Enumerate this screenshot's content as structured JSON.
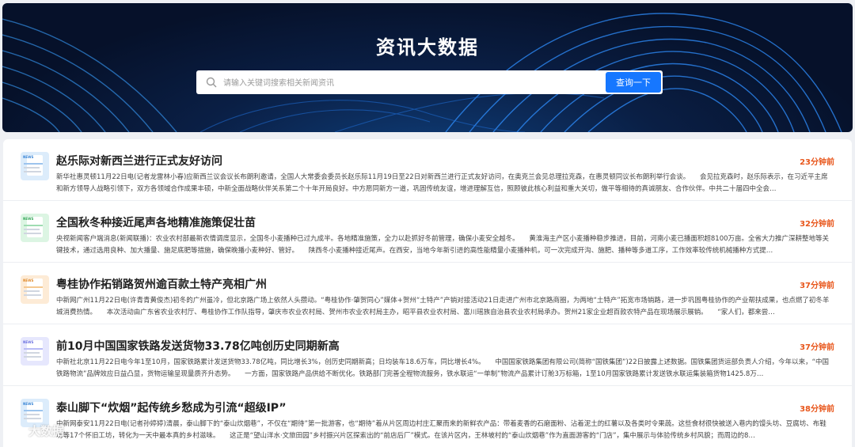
{
  "header": {
    "title": "资讯大数据",
    "search": {
      "placeholder": "请输入关键词搜索相关新闻资讯",
      "value": "",
      "button_label": "查询一下"
    }
  },
  "news": [
    {
      "title": "赵乐际对新西兰进行正式友好访问",
      "time": "23分钟前",
      "summary": "新华社惠灵顿11月22日电(记者龙雷林小春)应新西兰议会议长布朗利邀请，全国人大常委会委员长赵乐际11月19日至22日对新西兰进行正式友好访问，在奥克兰会见总理拉克森，在惠灵顿同议长布朗利举行会谈。　　会见拉克森时，赵乐际表示，在习近平主席和新方领导人战略引领下，双方各领域合作成果丰硕，中新全面战略伙伴关系第二个十年开局良好。中方愿同新方一道，巩固传统友谊，增进理解互信，照顾彼此核心利益和重大关切，做平等相待的真诚朋友、合作伙伴。中共二十届四中全会…",
      "icon": "news-document-icon",
      "icon_color": "#5aa7f0"
    },
    {
      "title": "全国秋冬种接近尾声各地精准施策促壮苗",
      "time": "32分钟前",
      "summary": "央视新闻客户端消息(新闻联播)：农业农村部最新农情调度显示，全国冬小麦播种已过九成半。各地精准施策，全力以赴抓好冬前管理，确保小麦安全越冬。　　黄淮海主产区小麦播种稳步推进，目前，河南小麦已播面积超8100万亩。全省大力推广深耕整地等关键技术，通过选用良种、加大播量、施足底肥等措施，确保晚播小麦种好、管好。　　陕西冬小麦播种接近尾声。在西安，当地今年新引进的高性能精量小麦播种机，可一次完成开沟、施肥、播种等多道工序，工作效率较传统机械播种方式提…",
      "icon": "news-document-icon",
      "icon_color": "#4cc26b"
    },
    {
      "title": "粤桂协作拓销路贺州逾百款土特产亮相广州",
      "time": "37分钟前",
      "summary": "中新网广州11月22日电(许青青黄俊杰)初冬的广州虽冷，但北京路广场上依然人头攒动。“粤桂协作·肇贺同心”媒体+贺州“土特产”产销对接活动21日走进广州市北京路商圈，为两地“土特产”拓宽市场销路，进一步巩固粤桂协作的产业帮扶成果，也点燃了初冬羊城消费热情。　　本次活动由广东省农业农村厅、粤桂协作工作队指导，肇庆市农业农村局、贺州市农业农村局主办，昭平县农业农村局、富川瑶族自治县农业农村局承办。贺州21家企业超百款农特产品在现场展示展销。　　“家人们，都来尝…",
      "icon": "news-document-icon",
      "icon_color": "#f0a24a"
    },
    {
      "title": "前10月中国国家铁路发送货物33.78亿吨创历史同期新高",
      "time": "37分钟前",
      "summary": "中新社北京11月22日电今年1至10月，国家铁路累计发送货物33.78亿吨，同比增长3%，创历史同期新高；日均装车18.6万车，同比增长4%。　　中国国家铁路集团有限公司(简称“国铁集团”)22日披露上述数据。国铁集团货运部负责人介绍，今年以来，“中国铁路物流”品牌效应日益凸显，货物运输呈现量质齐升态势。　　一方面，国家铁路产品供给不断优化。铁路部门完善全程物流服务，铁水联运“一单制”物流产品累计订舱3万标箱，1至10月国家铁路累计发送铁水联运集装箱货物1425.8万…",
      "icon": "news-document-icon",
      "icon_color": "#8b8ff0"
    },
    {
      "title": "泰山脚下“炊烟”起传统乡愁成为引流“超级IP”",
      "time": "38分钟前",
      "summary": "中新网泰安11月22日电(记者孙婷婷)清晨，泰山脚下的“泰山炊烟巷”，不仅在“期待”第一批游客，也“期待”着从片区周边村庄汇聚而来的新鲜农产品：带着麦香的石磨面粉、沾着泥土的红薯以及各类时令果蔬。这些食材很快被送入巷内的馒头坊、豆腐坊、布鞋坊等17个怀旧工坊，转化为一天中最本真的乡村滋味。　　这正是“望山洋水·文旅田园”乡村振兴片区探索出的“前店后厂”模式。在该片区内，王林坡村的“泰山炊烟巷”作为直面游客的“门店”，集中展示与体验传统乡村风貌；而周边的8…",
      "icon": "news-document-icon",
      "icon_color": "#5aa7f0"
    }
  ],
  "watermark": {
    "text": "大数据",
    "icon": "logo-spiral-icon"
  }
}
